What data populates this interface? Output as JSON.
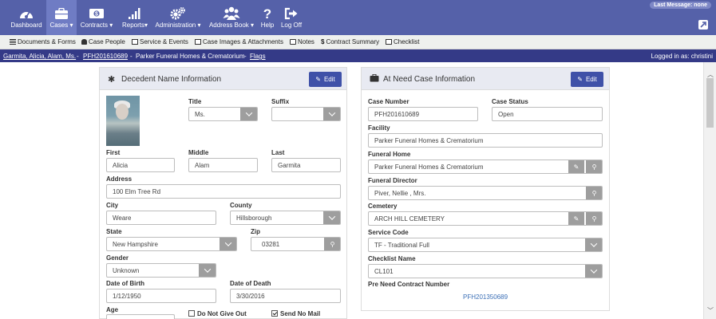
{
  "nav": {
    "items": [
      {
        "label": "Dashboard",
        "icon": "dashboard-icon"
      },
      {
        "label": "Cases",
        "icon": "briefcase-icon",
        "caret": "▾"
      },
      {
        "label": "Contracts",
        "icon": "dollar-bill-icon",
        "caret": "▾"
      },
      {
        "label": "Reports",
        "icon": "bar-chart-icon",
        "caret": "▾"
      },
      {
        "label": "Administration",
        "icon": "gears-icon",
        "caret": "▾"
      },
      {
        "label": "Address Book",
        "icon": "users-icon",
        "caret": "▾"
      },
      {
        "label": "Help",
        "icon": "question-icon"
      },
      {
        "label": "Log Off",
        "icon": "sign-out-icon"
      }
    ],
    "last_message": "Last Message: none",
    "colors": {
      "nav_bg": "#5561a9",
      "active_bg": "#6f7cc4",
      "crumb_bg": "#343a87",
      "button_blue": "#3f51a8"
    }
  },
  "subnav": {
    "items": [
      "Documents & Forms",
      "Case People",
      "Service & Events",
      "Case Images & Attachments",
      "Notes",
      "Contract Summary",
      "Checklist"
    ]
  },
  "crumbs": {
    "person": "Garmita, Alicia, Alam, Ms.",
    "sep1": "-",
    "case_number": "PFH201610689",
    "sep2": "-",
    "facility": "Parker Funeral Homes & Crematorium",
    "sep3": "-",
    "flags": "Flags",
    "logged_in": "Logged in as: christini"
  },
  "decedent": {
    "title": "Decedent Name Information",
    "edit": "Edit",
    "labels": {
      "title": "Title",
      "suffix": "Suffix",
      "first": "First",
      "middle": "Middle",
      "last": "Last",
      "address": "Address",
      "city": "City",
      "county": "County",
      "state": "State",
      "zip": "Zip",
      "gender": "Gender",
      "dob": "Date of Birth",
      "dod": "Date of Death",
      "age": "Age",
      "do_not_give_out": "Do Not Give Out",
      "send_no_mail": "Send No Mail"
    },
    "values": {
      "title": "Ms.",
      "suffix": "",
      "first": "Alicia",
      "middle": "Alam",
      "last": "Garmita",
      "address": "100 Elm Tree Rd",
      "city": "Weare",
      "county": "Hillsborough",
      "state": "New Hampshire",
      "zip": "03281",
      "gender": "Unknown",
      "dob": "1/12/1950",
      "dod": "3/30/2016",
      "do_not_give_out": false,
      "send_no_mail": true
    }
  },
  "atneed": {
    "title": "At Need Case Information",
    "edit": "Edit",
    "labels": {
      "case_number": "Case Number",
      "case_status": "Case Status",
      "facility": "Facility",
      "funeral_home": "Funeral Home",
      "funeral_director": "Funeral Director",
      "cemetery": "Cemetery",
      "service_code": "Service Code",
      "checklist_name": "Checklist Name",
      "preneed": "Pre Need Contract Number"
    },
    "values": {
      "case_number": "PFH201610689",
      "case_status": "Open",
      "facility": "Parker Funeral Homes & Crematorium",
      "funeral_home": "Parker Funeral Homes & Crematorium",
      "funeral_director": "Piver, Nellie , Mrs.",
      "cemetery": "ARCH HILL CEMETERY",
      "service_code": "TF - Traditional Full",
      "checklist_name": "CL101",
      "preneed": "PFH201350689"
    }
  }
}
